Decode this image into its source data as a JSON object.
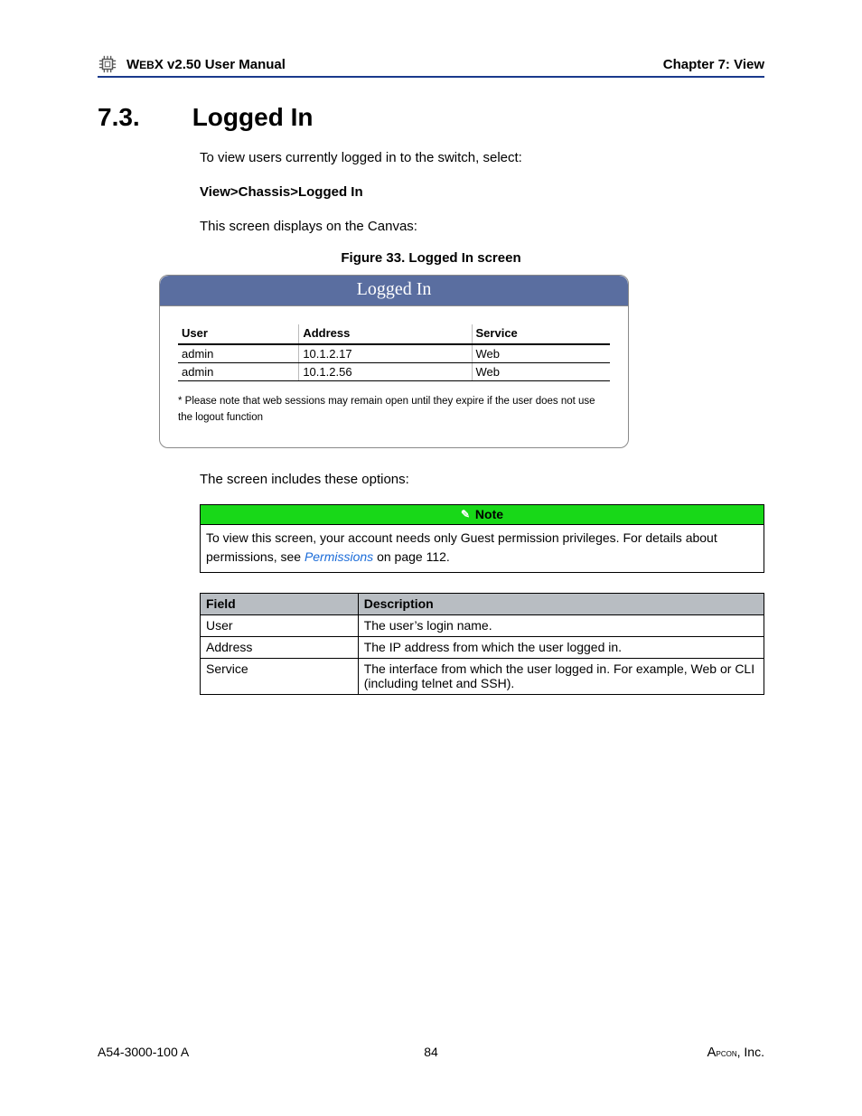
{
  "header": {
    "manual_title_a": "W",
    "manual_title_b": "EB",
    "manual_title_c": "X v2.50 User Manual",
    "chapter": "Chapter 7: View"
  },
  "section": {
    "number": "7.3.",
    "title": "Logged In",
    "intro1": "To view users currently logged in to the switch, select:",
    "path": "View>Chassis>Logged In",
    "intro2": "This screen displays on the Canvas:",
    "figure_caption": "Figure 33. Logged In screen",
    "after_fig": "The screen includes these options:"
  },
  "figure": {
    "titlebar": "Logged In",
    "columns": [
      "User",
      "Address",
      "Service"
    ],
    "rows": [
      [
        "admin",
        "10.1.2.17",
        "Web"
      ],
      [
        "admin",
        "10.1.2.56",
        "Web"
      ]
    ],
    "footnote": "* Please note that web sessions may remain open until they expire if the user does not use the logout function"
  },
  "note": {
    "head": "Note",
    "body_a": "To view this screen, your account needs only Guest permission privileges. For details about permissions, see ",
    "link": "Permissions",
    "body_b": " on page 112."
  },
  "field_table": {
    "headers": [
      "Field",
      "Description"
    ],
    "rows": [
      [
        "User",
        "The user’s login name."
      ],
      [
        "Address",
        "The IP address from which the user logged in."
      ],
      [
        "Service",
        "The interface from which the user logged in. For example, Web or CLI (including telnet and SSH)."
      ]
    ]
  },
  "footer": {
    "left": "A54-3000-100 A",
    "center": "84",
    "right_a": "A",
    "right_b": "pcon",
    "right_c": ", Inc."
  }
}
